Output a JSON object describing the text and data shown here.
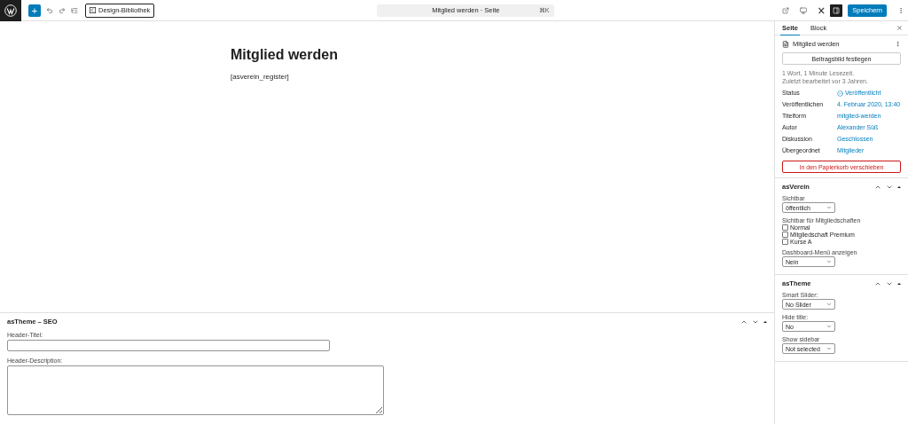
{
  "toolbar": {
    "add_button": "+",
    "library_button": "Design-Bibliothek",
    "document_title": "Mitglied werden · Seite",
    "shortcut": "⌘K",
    "save_button": "Speichern"
  },
  "editor": {
    "title": "Mitglied werden",
    "content": "[asverein_register]"
  },
  "seo_panel": {
    "title": "asTheme – SEO",
    "fields": [
      {
        "label": "Header-Titel:",
        "kind": "input"
      },
      {
        "label": "Header-Description:",
        "kind": "textarea"
      }
    ]
  },
  "sidebar": {
    "tabs": [
      {
        "label": "Seite",
        "selected": true
      },
      {
        "label": "Block",
        "selected": false
      }
    ],
    "page_title": "Mitglied werden",
    "featured_button": "Beitragsbild festlegen",
    "info": [
      "1 Wort, 1 Minute Lesezeit.",
      "Zuletzt bearbeitet vor 3 Jahren."
    ],
    "meta": [
      {
        "label": "Status",
        "value": "Veröffentlicht",
        "kind": "status"
      },
      {
        "label": "Veröffentlichen",
        "value": "4. Februar 2020, 13:40",
        "kind": "link"
      },
      {
        "label": "Titelform",
        "value": "mitglied-werden",
        "kind": "link"
      },
      {
        "label": "Autor",
        "value": "Alexander Süß",
        "kind": "link"
      },
      {
        "label": "Diskussion",
        "value": "Geschlossen",
        "kind": "link"
      },
      {
        "label": "Übergeordnet",
        "value": "Mitglieder",
        "kind": "link"
      }
    ],
    "trash_button": "In den Papierkorb verschieben",
    "panels": [
      {
        "title": "asVerein",
        "fields": [
          {
            "kind": "select",
            "label": "Sichtbar",
            "value": "öffentlich"
          },
          {
            "kind": "checkboxes",
            "label": "Sichtbar für Mitgliedschaften",
            "options": [
              {
                "label": "Normal",
                "checked": false
              },
              {
                "label": "Mitgliedschaft Premium",
                "checked": false
              },
              {
                "label": "Kurse A",
                "checked": false
              }
            ]
          },
          {
            "kind": "select",
            "label": "Dashboard-Menü anzeigen",
            "value": "Nein"
          }
        ]
      },
      {
        "title": "asTheme",
        "fields": [
          {
            "kind": "select",
            "label": "Smart Slider:",
            "value": "No Slider"
          },
          {
            "kind": "select",
            "label": "Hide title:",
            "value": "No"
          },
          {
            "kind": "select",
            "label": "Show sidebar",
            "value": "Not selected"
          }
        ]
      }
    ]
  }
}
